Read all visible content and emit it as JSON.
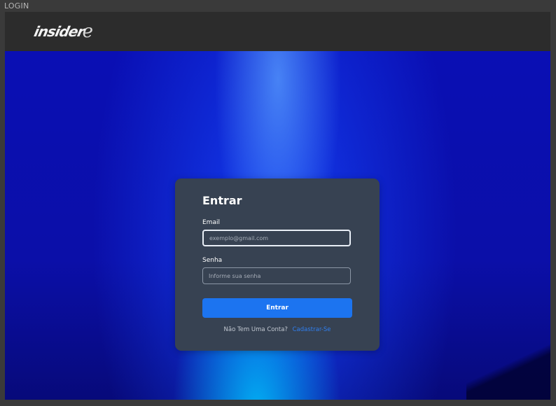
{
  "window": {
    "title": "LOGIN"
  },
  "header": {
    "logo_text": "insider",
    "logo_swoosh": "e"
  },
  "login": {
    "title": "Entrar",
    "email_label": "Email",
    "email_placeholder": "exemplo@gmail.com",
    "email_value": "",
    "password_label": "Senha",
    "password_placeholder": "Informe sua senha",
    "password_value": "",
    "submit_label": "Entrar",
    "no_account_text": "Não Tem Uma Conta?",
    "signup_link": "Cadastrar-Se"
  },
  "colors": {
    "card_bg": "#374252",
    "button_bg": "#1c74f0",
    "link": "#2f7ff0",
    "hero_blue": "#0a0fb4",
    "topbar_bg": "#2c2c2c"
  }
}
